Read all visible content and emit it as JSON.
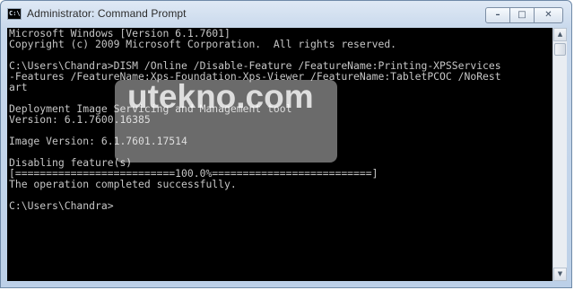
{
  "window": {
    "title": "Administrator: Command Prompt",
    "icon_label": "C:\\",
    "controls": {
      "minimize": "–",
      "maximize": "□",
      "close": "✕"
    }
  },
  "console": {
    "lines": [
      "Microsoft Windows [Version 6.1.7601]",
      "Copyright (c) 2009 Microsoft Corporation.  All rights reserved.",
      "",
      "C:\\Users\\Chandra>DISM /Online /Disable-Feature /FeatureName:Printing-XPSServices",
      "-Features /FeatureName:Xps-Foundation-Xps-Viewer /FeatureName:TabletPCOC /NoRest",
      "art",
      "",
      "Deployment Image Servicing and Management tool",
      "Version: 6.1.7600.16385",
      "",
      "Image Version: 6.1.7601.17514",
      "",
      "Disabling feature(s)",
      "[==========================100.0%==========================]",
      "The operation completed successfully.",
      "",
      "C:\\Users\\Chandra>"
    ]
  },
  "watermark": {
    "text": "utekno.com"
  },
  "scrollbar": {
    "up_icon": "chevron-up-icon",
    "down_icon": "chevron-down-icon",
    "up_glyph": "▲",
    "down_glyph": "▼"
  }
}
